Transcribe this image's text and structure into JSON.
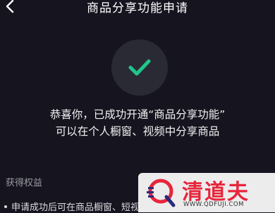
{
  "header": {
    "title": "商品分享功能申请",
    "back_icon": "chevron-left-icon"
  },
  "status": {
    "icon": "checkmark-icon",
    "accent_color": "#20c58a",
    "message_line1": "恭喜你，已成功开通“商品分享功能”",
    "message_line2": "可以在个人橱窗、视频中分享商品"
  },
  "benefits": {
    "title": "获得权益",
    "items": [
      {
        "text": "申请成功后可在商品橱窗、短视"
      }
    ]
  },
  "watermark": {
    "name": "清道夫",
    "url": "WWW.QDFUJI.COM",
    "brand_color": "#e8253b"
  }
}
